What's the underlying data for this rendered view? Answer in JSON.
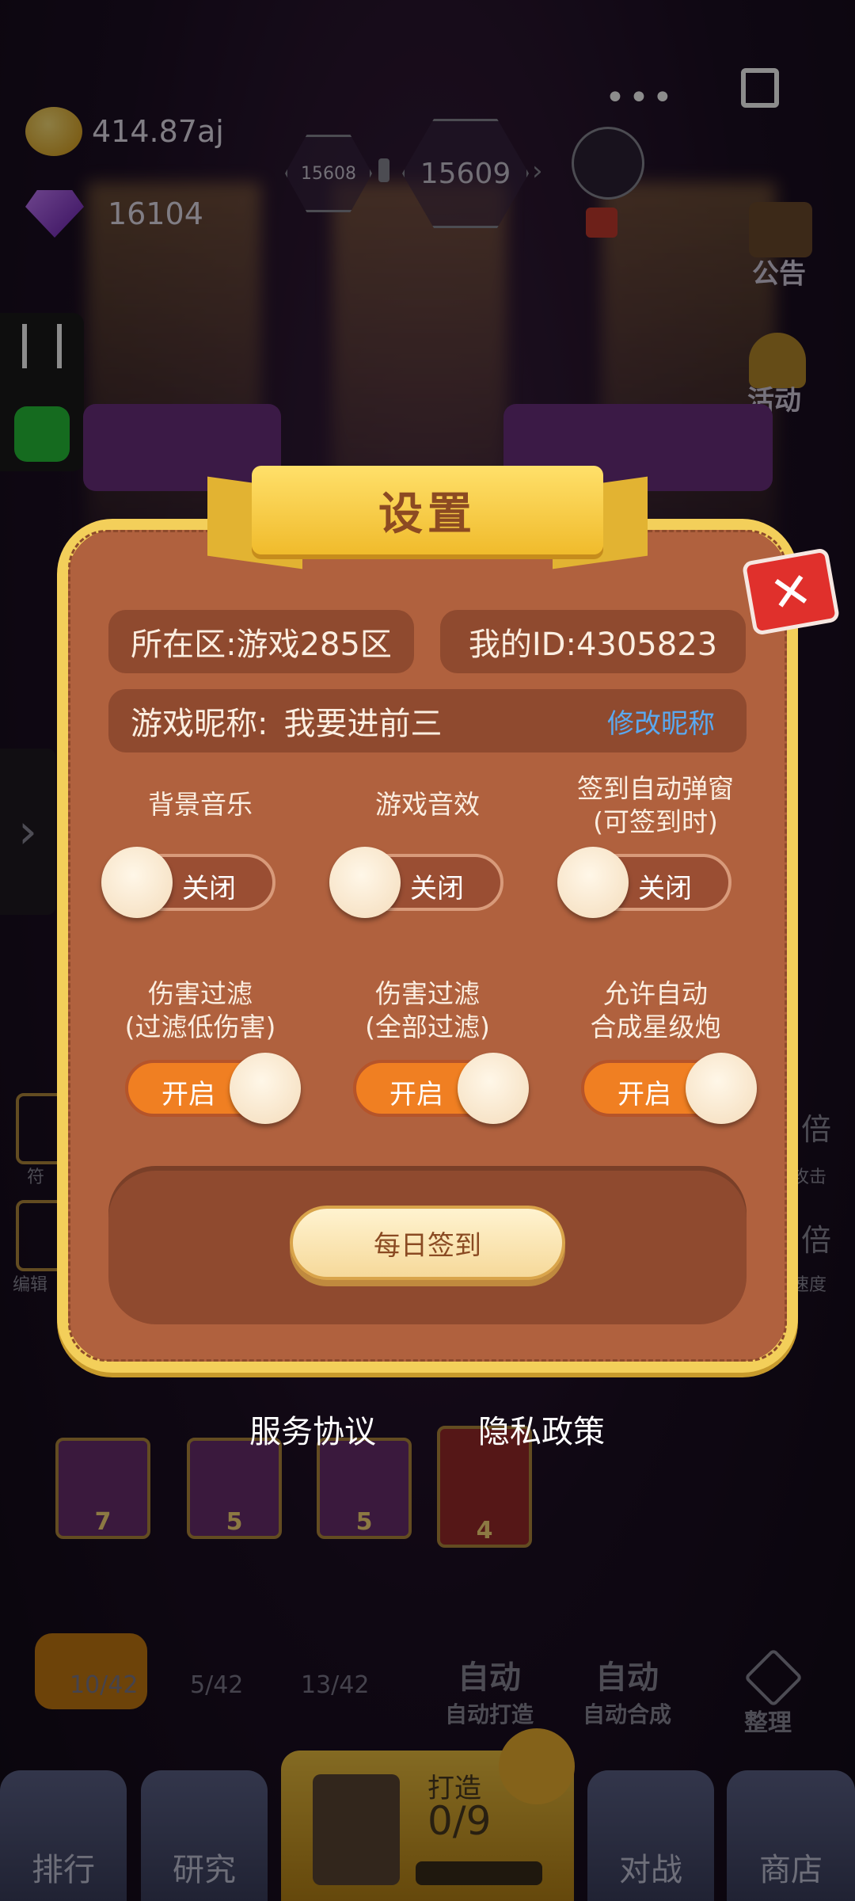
{
  "top": {
    "coins": "414.87aj",
    "gems": "16104",
    "level_prev": "15608",
    "level_current": "15609"
  },
  "side": {
    "notice": "公告",
    "event": "活动",
    "left_tags": [
      "符",
      "编辑"
    ],
    "right_tags": [
      "倍",
      "攻击",
      "倍",
      "速度"
    ]
  },
  "settings": {
    "title": "设置",
    "zone": "所在区:游戏285区",
    "id": "我的ID:4305823",
    "nickname_label": "游戏昵称:",
    "nickname": "我要进前三",
    "rename": "修改昵称",
    "options": [
      {
        "line1": "背景音乐",
        "line2": "",
        "state": "关闭",
        "on": false
      },
      {
        "line1": "游戏音效",
        "line2": "",
        "state": "关闭",
        "on": false
      },
      {
        "line1": "签到自动弹窗",
        "line2": "(可签到时)",
        "state": "关闭",
        "on": false
      },
      {
        "line1": "伤害过滤",
        "line2": "(过滤低伤害)",
        "state": "开启",
        "on": true
      },
      {
        "line1": "伤害过滤",
        "line2": "(全部过滤)",
        "state": "开启",
        "on": true
      },
      {
        "line1": "允许自动",
        "line2": "合成星级炮",
        "state": "开启",
        "on": true
      }
    ],
    "daily_signin": "每日签到"
  },
  "links": {
    "service": "服务协议",
    "privacy": "隐私政策"
  },
  "board": {
    "tile_levels": [
      "7",
      "5",
      "5",
      "4"
    ]
  },
  "bottom": {
    "counts": [
      "10/42",
      "5/42",
      "13/42"
    ],
    "auto_forge_title": "自动",
    "auto_forge_sub": "自动打造",
    "auto_merge_title": "自动",
    "auto_merge_sub": "自动合成",
    "organize": "整理",
    "craft_label": "打造",
    "craft_progress": "0/9",
    "nav": [
      "排行",
      "研究",
      "对战",
      "商店"
    ]
  }
}
